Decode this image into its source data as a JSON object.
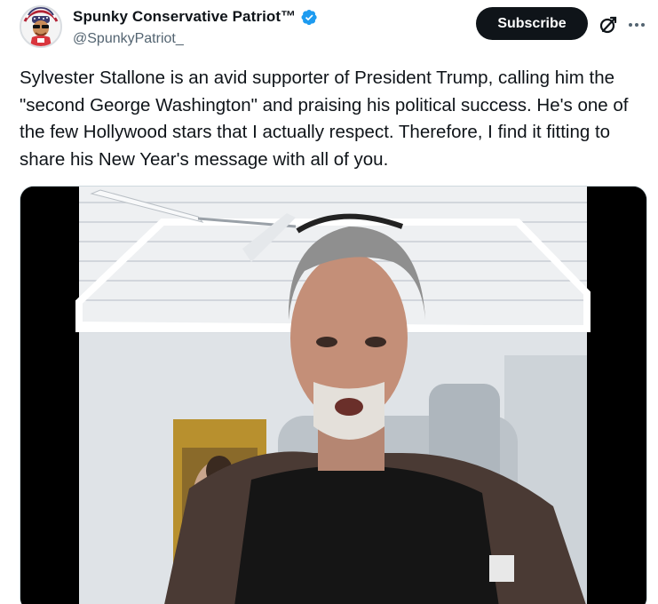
{
  "tweet": {
    "display_name": "Spunky Conservative Patriot™",
    "handle": "@SpunkyPatriot_",
    "subscribe_label": "Subscribe",
    "text": "Sylvester Stallone is an avid supporter of President Trump, calling him the \"second George Washington\" and praising his political success. He's one of the few Hollywood stars that I actually respect. Therefore, I find it fitting to share his New Year's message with all of you."
  },
  "icons": {
    "verified": "verified-badge-icon",
    "grok": "grok-icon",
    "more": "more-options-icon"
  },
  "colors": {
    "text": "#0f1419",
    "secondary_text": "#536471",
    "verified_blue": "#1d9bf0",
    "subscribe_bg": "#0f1419"
  }
}
